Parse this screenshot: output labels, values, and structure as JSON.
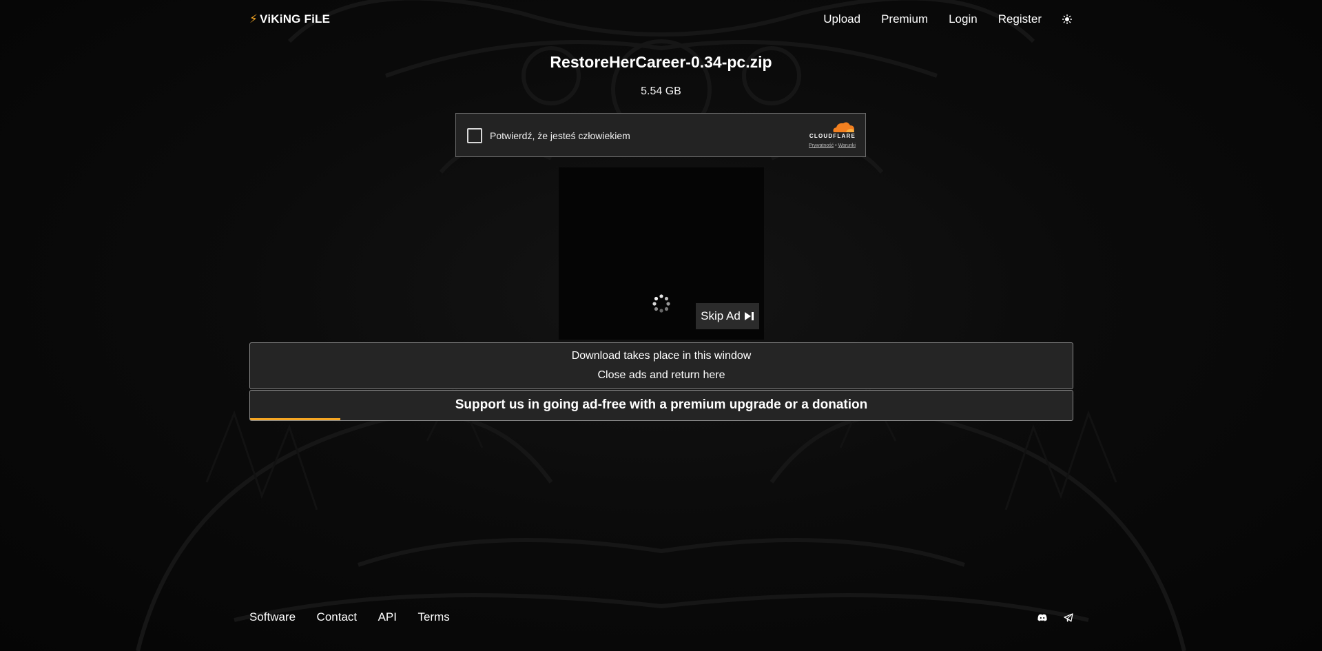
{
  "header": {
    "logo_text": "ViKiNG FiLE",
    "logo_icon": "lightning-bolt-icon",
    "nav": [
      "Upload",
      "Premium",
      "Login",
      "Register"
    ],
    "theme_icon": "sun-icon"
  },
  "file": {
    "name": "RestoreHerCareer-0.34-pc.zip",
    "size": "5.54 GB"
  },
  "captcha": {
    "label": "Potwierdź, że jesteś człowiekiem",
    "brand": "CLOUDFLARE",
    "privacy": "Prywatność",
    "separator": "•",
    "terms": "Warunki"
  },
  "ad": {
    "skip_label": "Skip Ad",
    "skip_icon": "skip-next-icon",
    "spinner_icon": "loading-spinner-icon"
  },
  "info": {
    "line1": "Download takes place in this window",
    "line2": "Close ads and return here"
  },
  "support": {
    "text": "Support us in going ad-free with a premium upgrade or a donation",
    "progress_percent": 11
  },
  "footer": {
    "links": [
      "Software",
      "Contact",
      "API",
      "Terms"
    ],
    "icons": [
      "discord-icon",
      "telegram-icon"
    ]
  },
  "colors": {
    "accent": "#f5a623",
    "panel_bg": "#252525",
    "page_bg": "#000000"
  }
}
